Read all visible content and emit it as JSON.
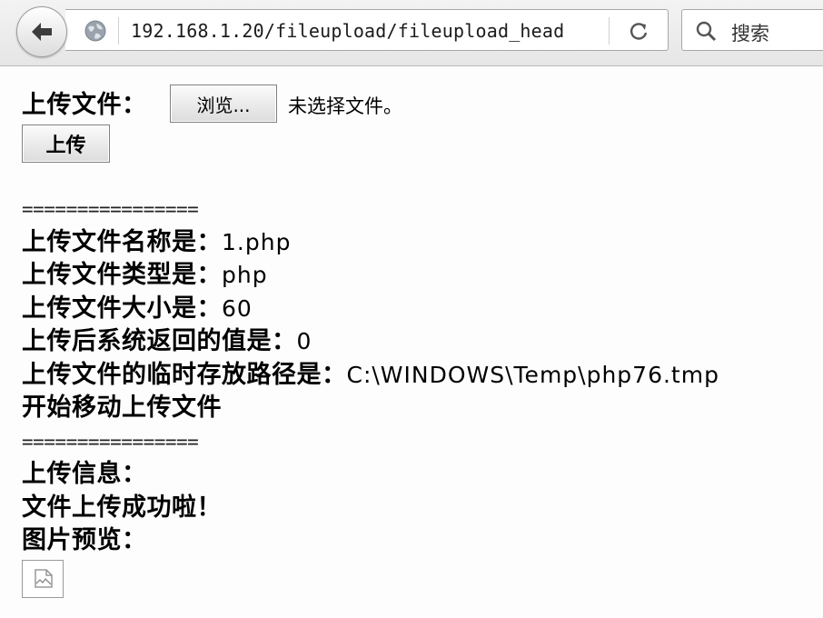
{
  "browser": {
    "url": "192.168.1.20/fileupload/fileupload_head",
    "search_placeholder": "搜索"
  },
  "form": {
    "file_label": "上传文件：",
    "browse_button": "浏览...",
    "no_file_text": "未选择文件。",
    "submit_button": "上传"
  },
  "result": {
    "separator_top": "================",
    "name_label": "上传文件名称是：",
    "name_value": "1.php",
    "type_label": "上传文件类型是：",
    "type_value": "php",
    "size_label": "上传文件大小是：",
    "size_value": "60",
    "return_label": "上传后系统返回的值是：",
    "return_value": "0",
    "temp_label": "上传文件的临时存放路径是：",
    "temp_value": "C:\\WINDOWS\\Temp\\php76.tmp",
    "moving_text": "开始移动上传文件",
    "separator_bottom": "================",
    "info_label": "上传信息：",
    "success_text": "文件上传成功啦！",
    "preview_label": "图片预览："
  },
  "icons": {
    "back": "back-arrow-icon",
    "site": "globe-icon",
    "reload": "reload-icon",
    "search": "search-icon",
    "broken_image": "broken-image-icon"
  }
}
